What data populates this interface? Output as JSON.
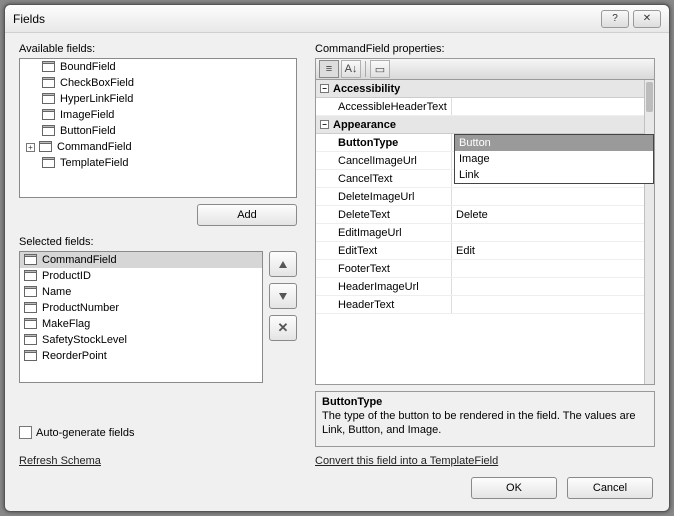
{
  "window": {
    "title": "Fields"
  },
  "labels": {
    "available": "Available fields:",
    "selected": "Selected fields:",
    "properties": "CommandField properties:",
    "add": "Add",
    "autogen": "Auto-generate fields",
    "refresh": "Refresh Schema",
    "convert": "Convert this field into a TemplateField",
    "ok": "OK",
    "cancel": "Cancel"
  },
  "available_fields": [
    {
      "name": "BoundField",
      "expandable": false
    },
    {
      "name": "CheckBoxField",
      "expandable": false
    },
    {
      "name": "HyperLinkField",
      "expandable": false
    },
    {
      "name": "ImageField",
      "expandable": false
    },
    {
      "name": "ButtonField",
      "expandable": false
    },
    {
      "name": "CommandField",
      "expandable": true
    },
    {
      "name": "TemplateField",
      "expandable": false
    }
  ],
  "selected_fields": [
    {
      "name": "CommandField",
      "selected": true
    },
    {
      "name": "ProductID"
    },
    {
      "name": "Name"
    },
    {
      "name": "ProductNumber"
    },
    {
      "name": "MakeFlag"
    },
    {
      "name": "SafetyStockLevel"
    },
    {
      "name": "ReorderPoint"
    }
  ],
  "prop_categories": [
    {
      "name": "Accessibility",
      "props": [
        {
          "name": "AccessibleHeaderText",
          "value": ""
        }
      ]
    },
    {
      "name": "Appearance",
      "props": [
        {
          "name": "ButtonType",
          "value": "Button",
          "selected": true,
          "dropdown": true
        },
        {
          "name": "CancelImageUrl",
          "value": ""
        },
        {
          "name": "CancelText",
          "value": ""
        },
        {
          "name": "DeleteImageUrl",
          "value": ""
        },
        {
          "name": "DeleteText",
          "value": "Delete"
        },
        {
          "name": "EditImageUrl",
          "value": ""
        },
        {
          "name": "EditText",
          "value": "Edit"
        },
        {
          "name": "FooterText",
          "value": ""
        },
        {
          "name": "HeaderImageUrl",
          "value": ""
        },
        {
          "name": "HeaderText",
          "value": ""
        }
      ]
    }
  ],
  "dropdown_options": [
    "Button",
    "Image",
    "Link"
  ],
  "description": {
    "title": "ButtonType",
    "text": "The type of the button to be rendered in the field.  The values are Link, Button, and Image."
  },
  "toolbar_icons": {
    "categorized": "≡",
    "alpha": "A↓",
    "props": "▭"
  }
}
